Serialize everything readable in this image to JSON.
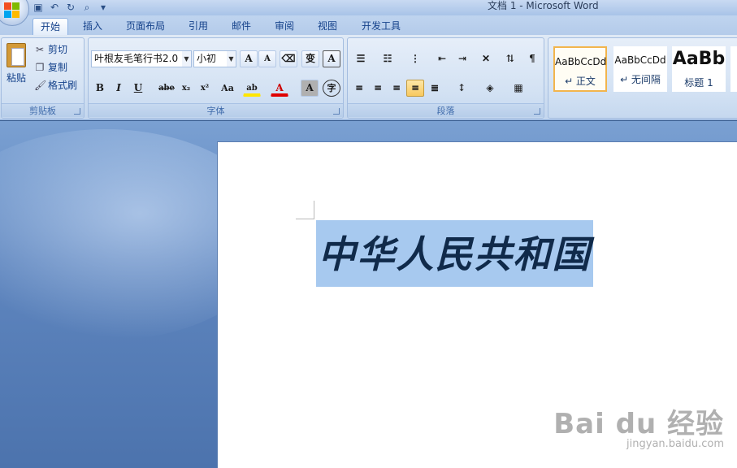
{
  "window": {
    "title": "文档 1 - Microsoft Word"
  },
  "quick_access": {
    "icons": [
      "save-icon",
      "undo-icon",
      "redo-icon",
      "print-preview-icon",
      "customize-icon"
    ]
  },
  "tabs": [
    "开始",
    "插入",
    "页面布局",
    "引用",
    "邮件",
    "审阅",
    "视图",
    "开发工具"
  ],
  "clipboard": {
    "group_label": "剪贴板",
    "paste_label": "粘贴",
    "cut_label": "剪切",
    "copy_label": "复制",
    "format_painter_label": "格式刷"
  },
  "font": {
    "group_label": "字体",
    "font_name": "叶根友毛笔行书2.0",
    "font_size": "小初",
    "grow_label": "A",
    "shrink_label": "A",
    "bold_label": "B",
    "italic_label": "I",
    "underline_label": "U",
    "strike_label": "abe",
    "subscript_label": "x₂",
    "superscript_label": "x²",
    "case_label": "Aa",
    "highlight_label": "ab",
    "font_color_label": "A",
    "char_shading_label": "A",
    "enclose_label": "字",
    "phonetic_label": "变",
    "clear_label": "A"
  },
  "paragraph": {
    "group_label": "段落"
  },
  "styles": {
    "items": [
      {
        "sample": "AaBbCcDd",
        "name": "↵ 正文"
      },
      {
        "sample": "AaBbCcDd",
        "name": "↵ 无间隔"
      },
      {
        "sample": "AaBb",
        "name": "标题 1"
      }
    ]
  },
  "document": {
    "text": "中华人民共和国"
  },
  "watermark": {
    "logo": "Bai du 经验",
    "url": "jingyan.baidu.com"
  }
}
